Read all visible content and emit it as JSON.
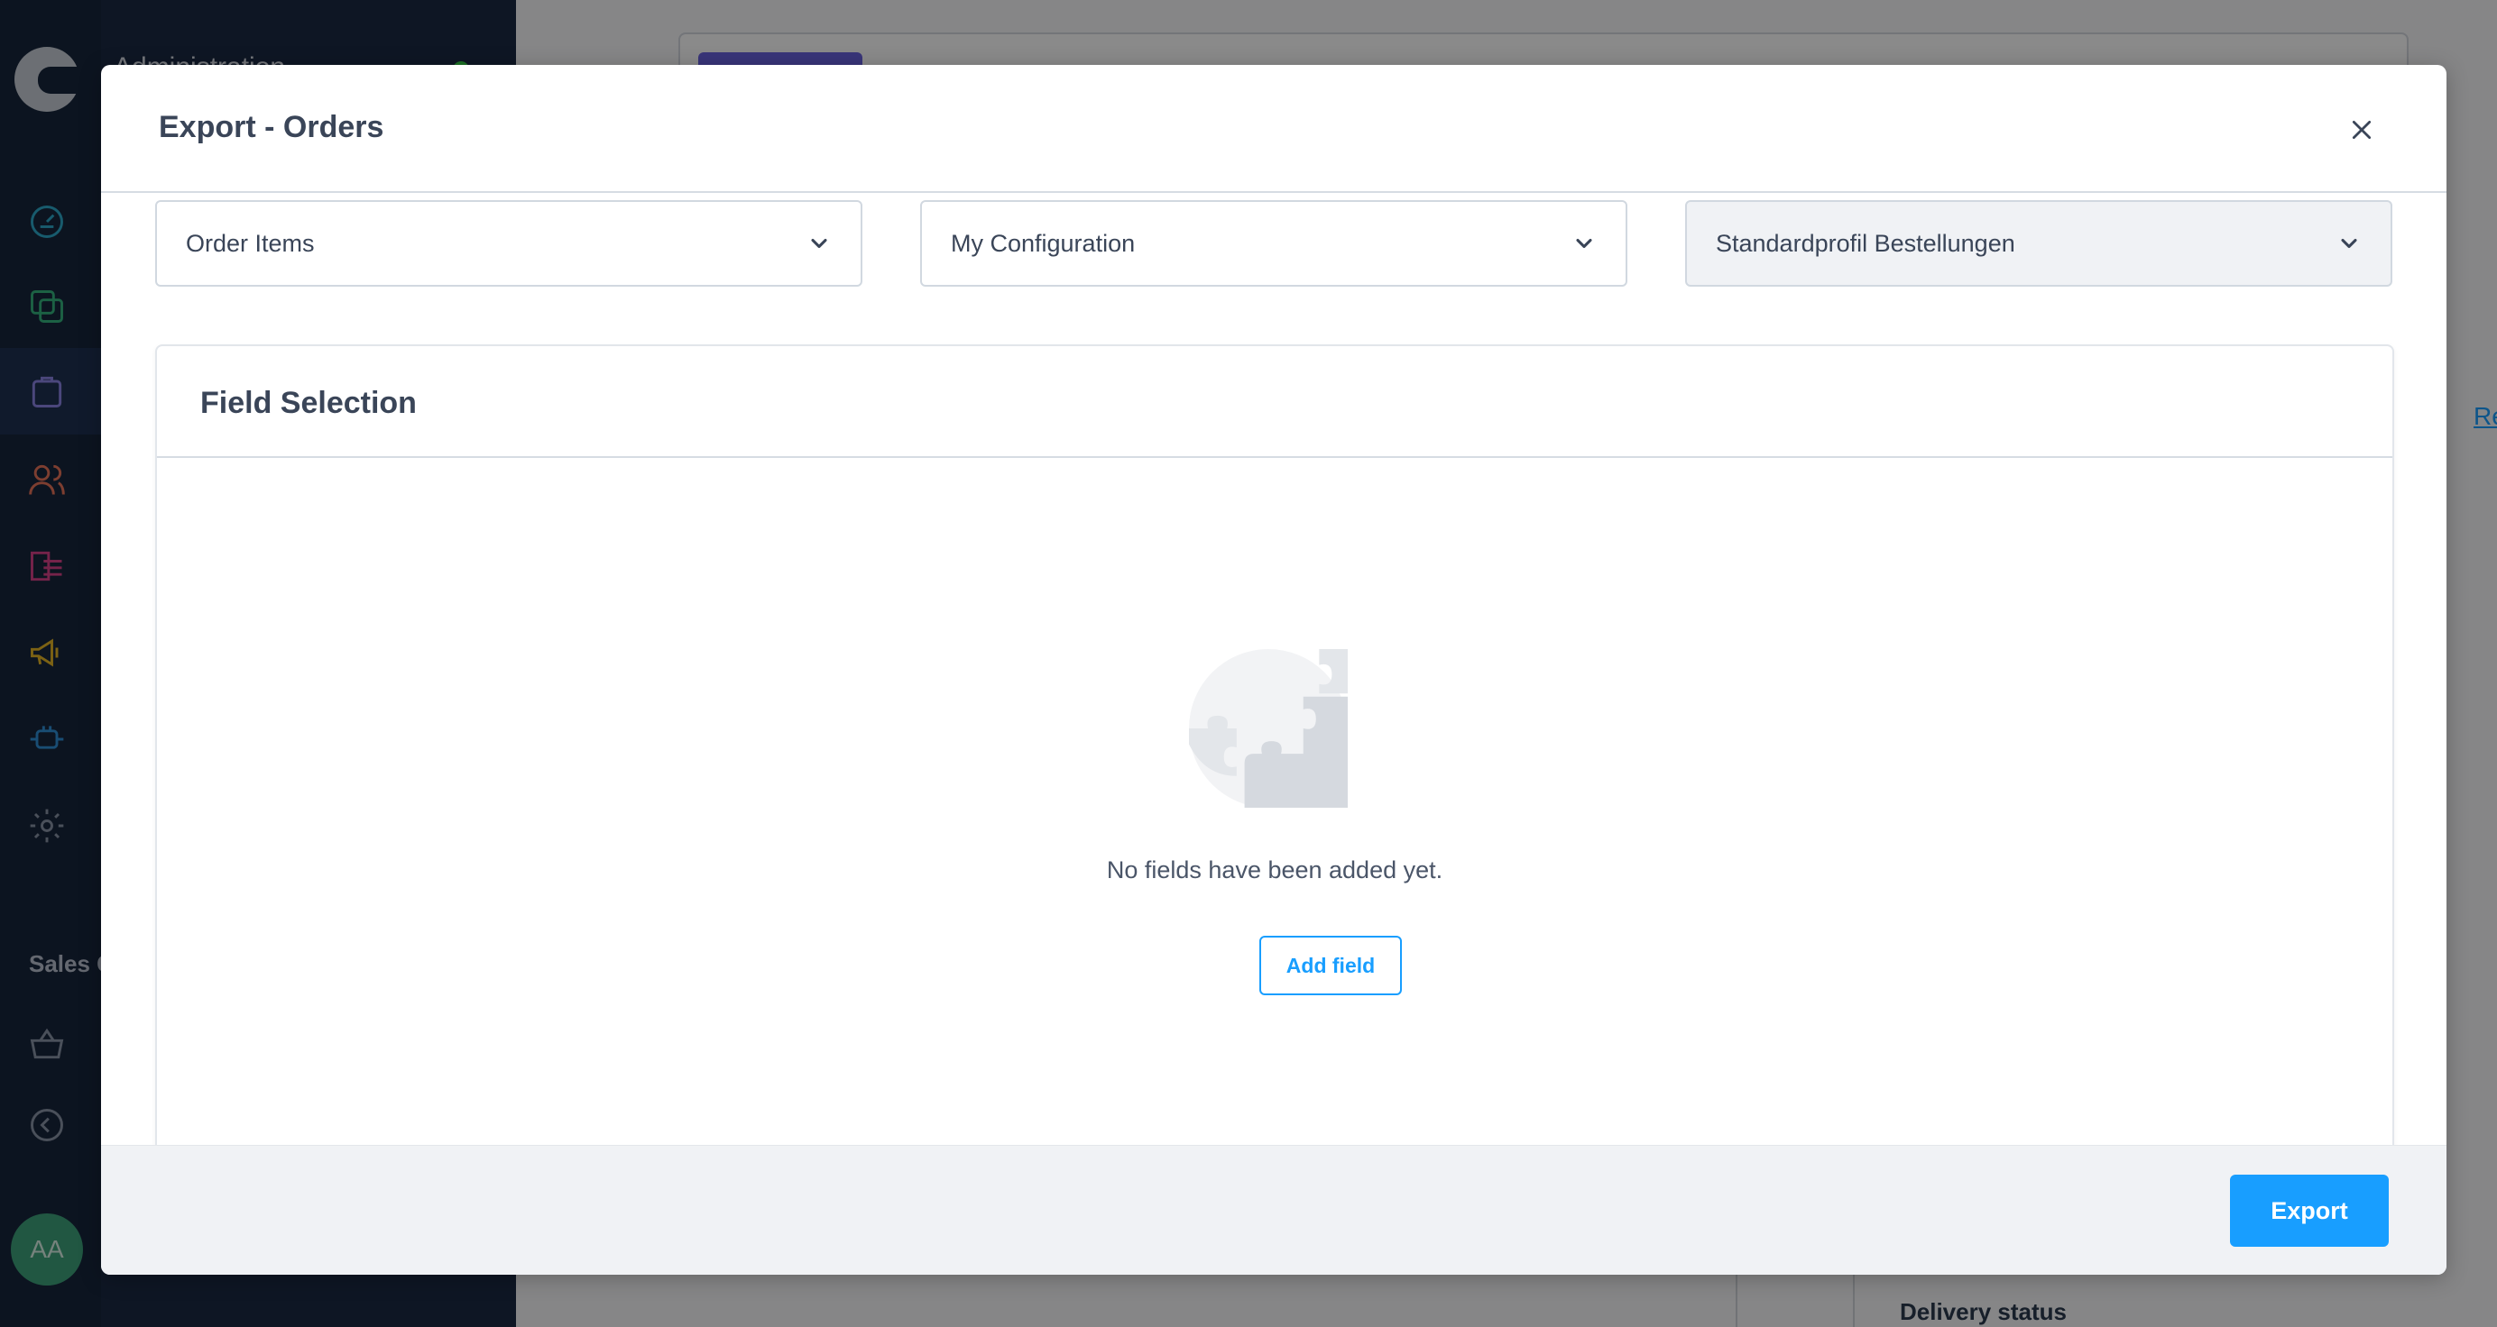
{
  "app": {
    "title": "Administration",
    "sidebar_section": "Sales C",
    "user_initials": "AA",
    "right_link": "Re",
    "delivery_status_label": "Delivery status"
  },
  "modal": {
    "title": "Export - Orders",
    "selects": [
      {
        "value": "Order Items",
        "disabled": false
      },
      {
        "value": "My Configuration",
        "disabled": false
      },
      {
        "value": "Standardprofil Bestellungen",
        "disabled": true
      }
    ],
    "field_selection": {
      "title": "Field Selection",
      "empty_text": "No fields have been added yet.",
      "add_button": "Add field"
    },
    "footer": {
      "export_button": "Export"
    }
  },
  "colors": {
    "primary": "#189eff",
    "sidebar": "#1b2a44",
    "status_online": "#37d046",
    "avatar": "#3ea27b"
  },
  "icons": [
    "dashboard-icon",
    "catalogue-icon",
    "orders-icon",
    "customers-icon",
    "content-icon",
    "marketing-icon",
    "extensions-icon",
    "settings-icon",
    "basket-icon",
    "collapse-icon",
    "close-icon",
    "chevron-down-icon",
    "puzzle-placeholder-icon"
  ]
}
